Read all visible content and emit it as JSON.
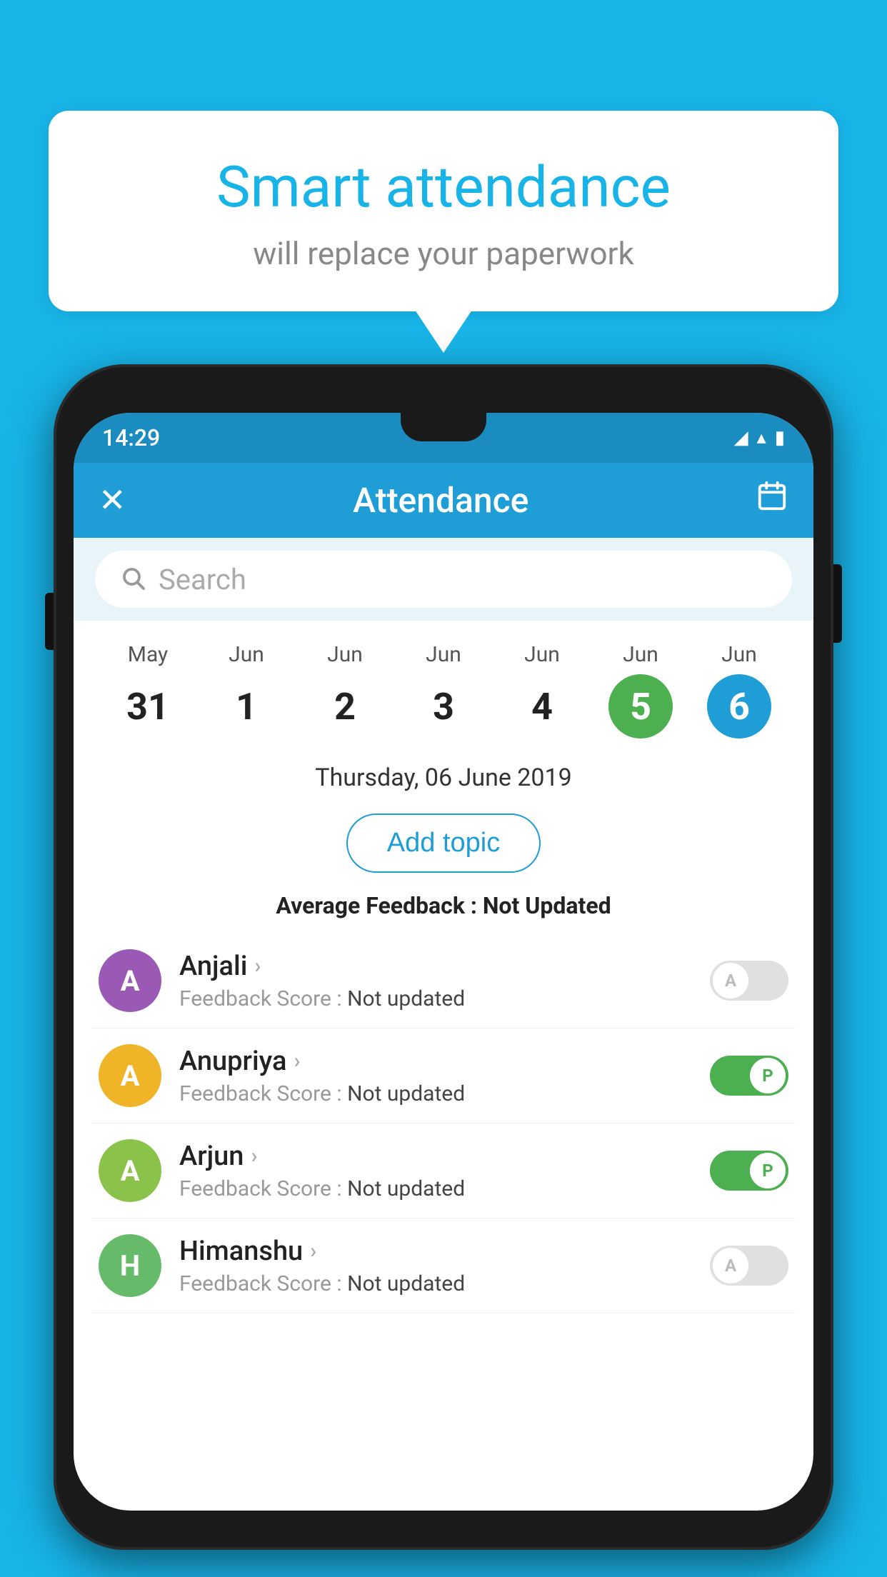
{
  "background": {
    "color": "#18b4e8"
  },
  "speech_bubble": {
    "title": "Smart attendance",
    "subtitle": "will replace your paperwork"
  },
  "status_bar": {
    "time": "14:29",
    "wifi": "▼",
    "signal": "▲",
    "battery": "▮"
  },
  "toolbar": {
    "close_icon": "✕",
    "title": "Attendance",
    "calendar_icon": "📅"
  },
  "search": {
    "placeholder": "Search"
  },
  "date_strip": [
    {
      "month": "May",
      "day": "31",
      "state": "normal"
    },
    {
      "month": "Jun",
      "day": "1",
      "state": "normal"
    },
    {
      "month": "Jun",
      "day": "2",
      "state": "normal"
    },
    {
      "month": "Jun",
      "day": "3",
      "state": "normal"
    },
    {
      "month": "Jun",
      "day": "4",
      "state": "normal"
    },
    {
      "month": "Jun",
      "day": "5",
      "state": "today"
    },
    {
      "month": "Jun",
      "day": "6",
      "state": "selected"
    }
  ],
  "selected_date": "Thursday, 06 June 2019",
  "add_topic_label": "Add topic",
  "avg_feedback": {
    "label": "Average Feedback : ",
    "value": "Not Updated"
  },
  "students": [
    {
      "name": "Anjali",
      "avatar_letter": "A",
      "avatar_color": "avatar-purple",
      "feedback_label": "Feedback Score : ",
      "feedback_value": "Not updated",
      "toggle_state": "off",
      "toggle_label": "A"
    },
    {
      "name": "Anupriya",
      "avatar_letter": "A",
      "avatar_color": "avatar-yellow",
      "feedback_label": "Feedback Score : ",
      "feedback_value": "Not updated",
      "toggle_state": "on",
      "toggle_label": "P"
    },
    {
      "name": "Arjun",
      "avatar_letter": "A",
      "avatar_color": "avatar-green-light",
      "feedback_label": "Feedback Score : ",
      "feedback_value": "Not updated",
      "toggle_state": "on",
      "toggle_label": "P"
    },
    {
      "name": "Himanshu",
      "avatar_letter": "H",
      "avatar_color": "avatar-green-medium",
      "feedback_label": "Feedback Score : ",
      "feedback_value": "Not updated",
      "toggle_state": "off",
      "toggle_label": "A"
    }
  ]
}
